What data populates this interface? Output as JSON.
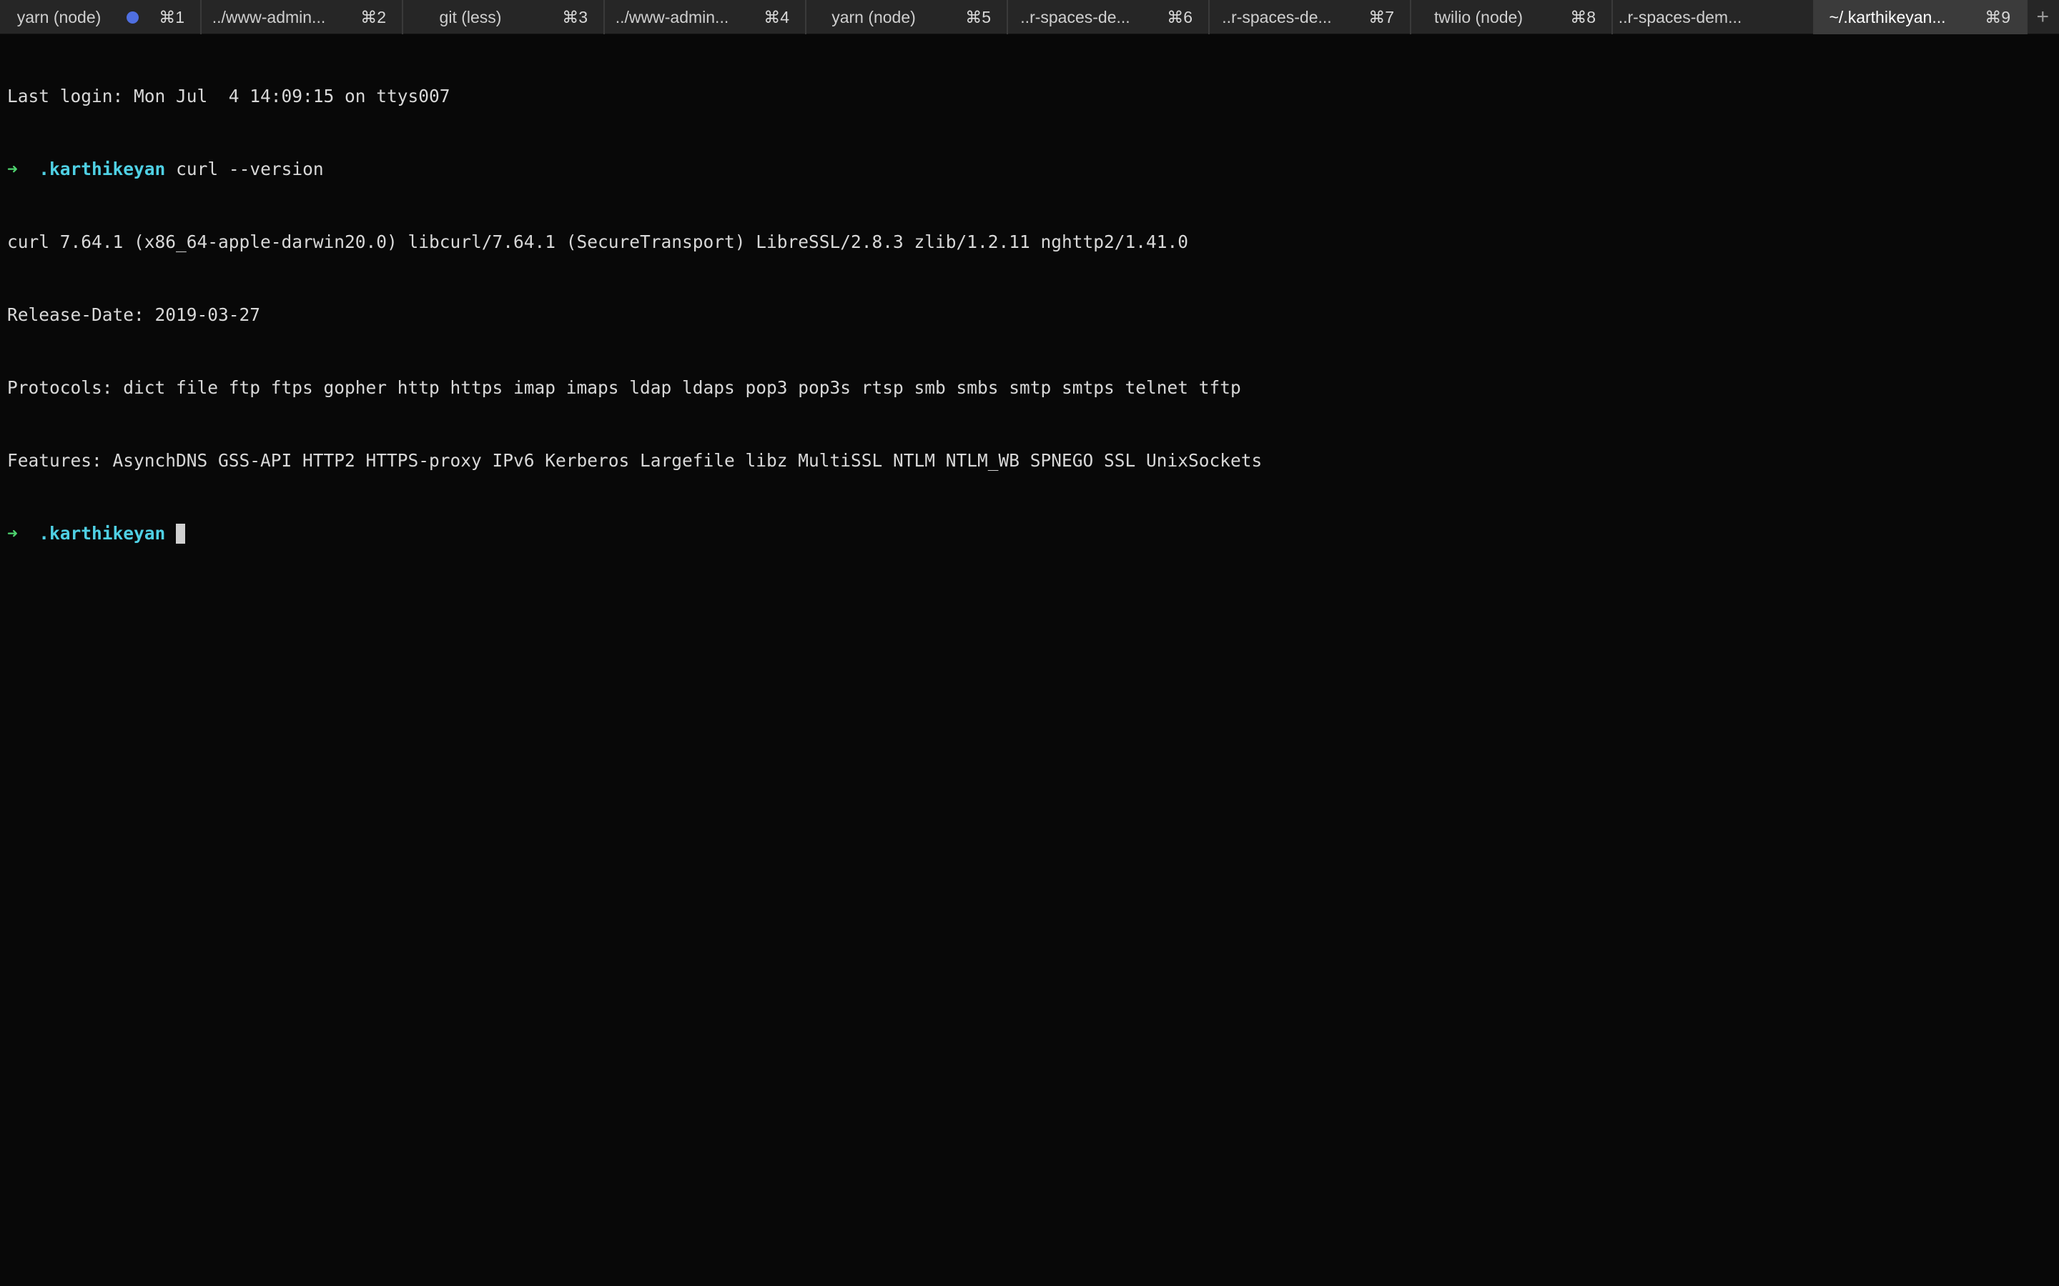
{
  "tabs": [
    {
      "title": "yarn (node)",
      "shortcut": "⌘1",
      "activity": true
    },
    {
      "title": "../www-admin...",
      "shortcut": "⌘2"
    },
    {
      "title": "git (less)",
      "shortcut": "⌘3"
    },
    {
      "title": "../www-admin...",
      "shortcut": "⌘4"
    },
    {
      "title": "yarn (node)",
      "shortcut": "⌘5"
    },
    {
      "title": "..r-spaces-de...",
      "shortcut": "⌘6"
    },
    {
      "title": "..r-spaces-de...",
      "shortcut": "⌘7"
    },
    {
      "title": "twilio (node)",
      "shortcut": "⌘8"
    },
    {
      "title": "..r-spaces-dem...",
      "shortcut": ""
    },
    {
      "title": "~/.karthikeyan...",
      "shortcut": "⌘9",
      "active": true
    }
  ],
  "new_tab_icon": "plus-icon",
  "terminal": {
    "last_login": "Last login: Mon Jul  4 14:09:15 on ttys007",
    "prompt_arrow": "➜",
    "prompt_dir": ".karthikeyan",
    "command": "curl --version",
    "output": [
      "curl 7.64.1 (x86_64-apple-darwin20.0) libcurl/7.64.1 (SecureTransport) LibreSSL/2.8.3 zlib/1.2.11 nghttp2/1.41.0",
      "Release-Date: 2019-03-27",
      "Protocols: dict file ftp ftps gopher http https imap imaps ldap ldaps pop3 pop3s rtsp smb smbs smtp smtps telnet tftp",
      "Features: AsynchDNS GSS-API HTTP2 HTTPS-proxy IPv6 Kerberos Largefile libz MultiSSL NTLM NTLM_WB SPNEGO SSL UnixSockets"
    ]
  },
  "colors": {
    "background": "#080808",
    "tab_bar": "#262626",
    "active_tab": "#3b3b3b",
    "prompt_arrow": "#4ed46f",
    "prompt_dir": "#4fd0e4",
    "activity_dot": "#4f6fe0"
  }
}
